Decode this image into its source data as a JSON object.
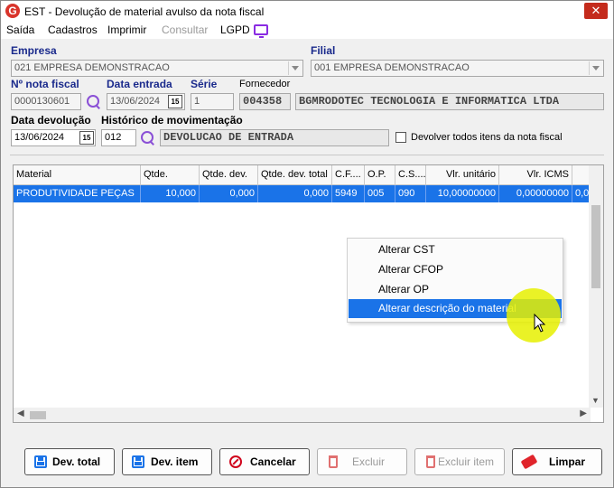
{
  "window": {
    "title": "EST - Devolução de material avulso da nota fiscal",
    "close_glyph": "✕"
  },
  "menu": {
    "items": [
      "Saída",
      "Cadastros",
      "Imprimir",
      "Consultar",
      "LGPD"
    ]
  },
  "form": {
    "empresa_label": "Empresa",
    "empresa_value": "021 EMPRESA DEMONSTRACAO",
    "filial_label": "Filial",
    "filial_value": "001 EMPRESA DEMONSTRACAO",
    "nota_label": "Nº nota fiscal",
    "nota_value": "0000130601",
    "data_entrada_label": "Data entrada",
    "data_entrada_value": "13/06/2024",
    "serie_label": "Série",
    "serie_value": "1",
    "fornecedor_label": "Fornecedor",
    "fornecedor_code": "004358",
    "fornecedor_name": "BGMRODOTEC TECNOLOGIA E INFORMATICA LTDA",
    "data_devolucao_label": "Data devolução",
    "data_devolucao_value": "13/06/2024",
    "historico_label": "Histórico de movimentação",
    "historico_code": "012",
    "historico_desc": "DEVOLUCAO DE ENTRADA",
    "devolver_todos_label": "Devolver todos itens da nota fiscal",
    "calendar_glyph": "15"
  },
  "grid": {
    "columns": [
      "Material",
      "Qtde.",
      "Qtde. dev.",
      "Qtde. dev. total",
      "C.F....",
      "O.P.",
      "C.S....",
      "Vlr. unitário",
      "Vlr. ICMS"
    ],
    "rows": [
      [
        "PRODUTIVIDADE PEÇAS",
        "10,000",
        "0,000",
        "0,000",
        "5949",
        "005",
        "090",
        "10,00000000",
        "0,00000000",
        "0,0"
      ]
    ]
  },
  "context_menu": {
    "items": [
      "Alterar CST",
      "Alterar CFOP",
      "Alterar OP",
      "Alterar descrição do material"
    ]
  },
  "buttons": {
    "dev_total": "Dev. total",
    "dev_item": "Dev. item",
    "cancelar": "Cancelar",
    "excluir": "Excluir",
    "excluir_item": "Excluir item",
    "limpar": "Limpar"
  }
}
